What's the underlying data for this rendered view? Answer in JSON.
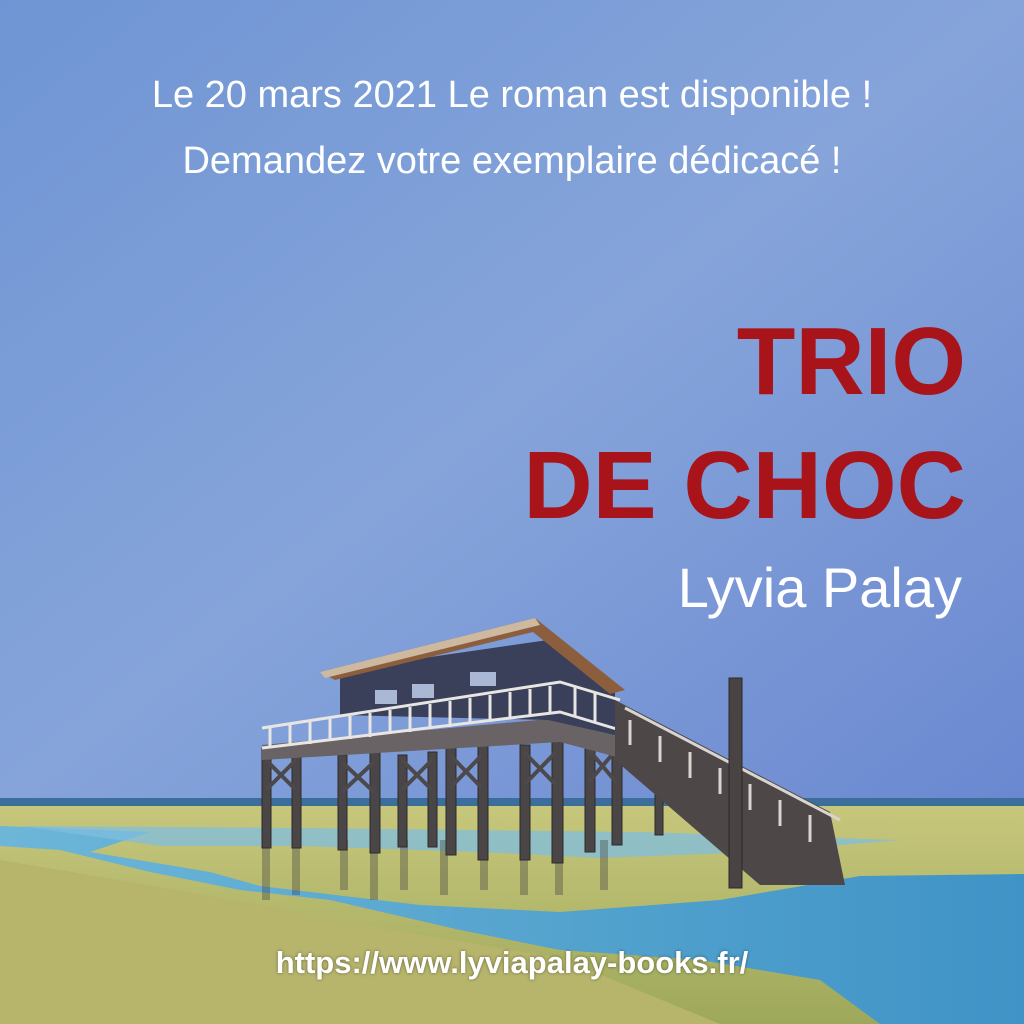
{
  "announcement": {
    "line1": "Le 20 mars 2021 Le roman est disponible !",
    "line2": "Demandez votre exemplaire dédicacé !"
  },
  "book": {
    "title_line1": "TRIO",
    "title_line2": "DE CHOC",
    "author": "Lyvia Palay"
  },
  "website": "https://www.lyviapalay-books.fr/",
  "colors": {
    "sky_top": "#6a8fd6",
    "sky_bottom": "#8aa7dd",
    "title_red": "#a8141a",
    "text_white": "#ffffff",
    "water": "#5fa7cf",
    "sand": "#b8bf6a"
  }
}
